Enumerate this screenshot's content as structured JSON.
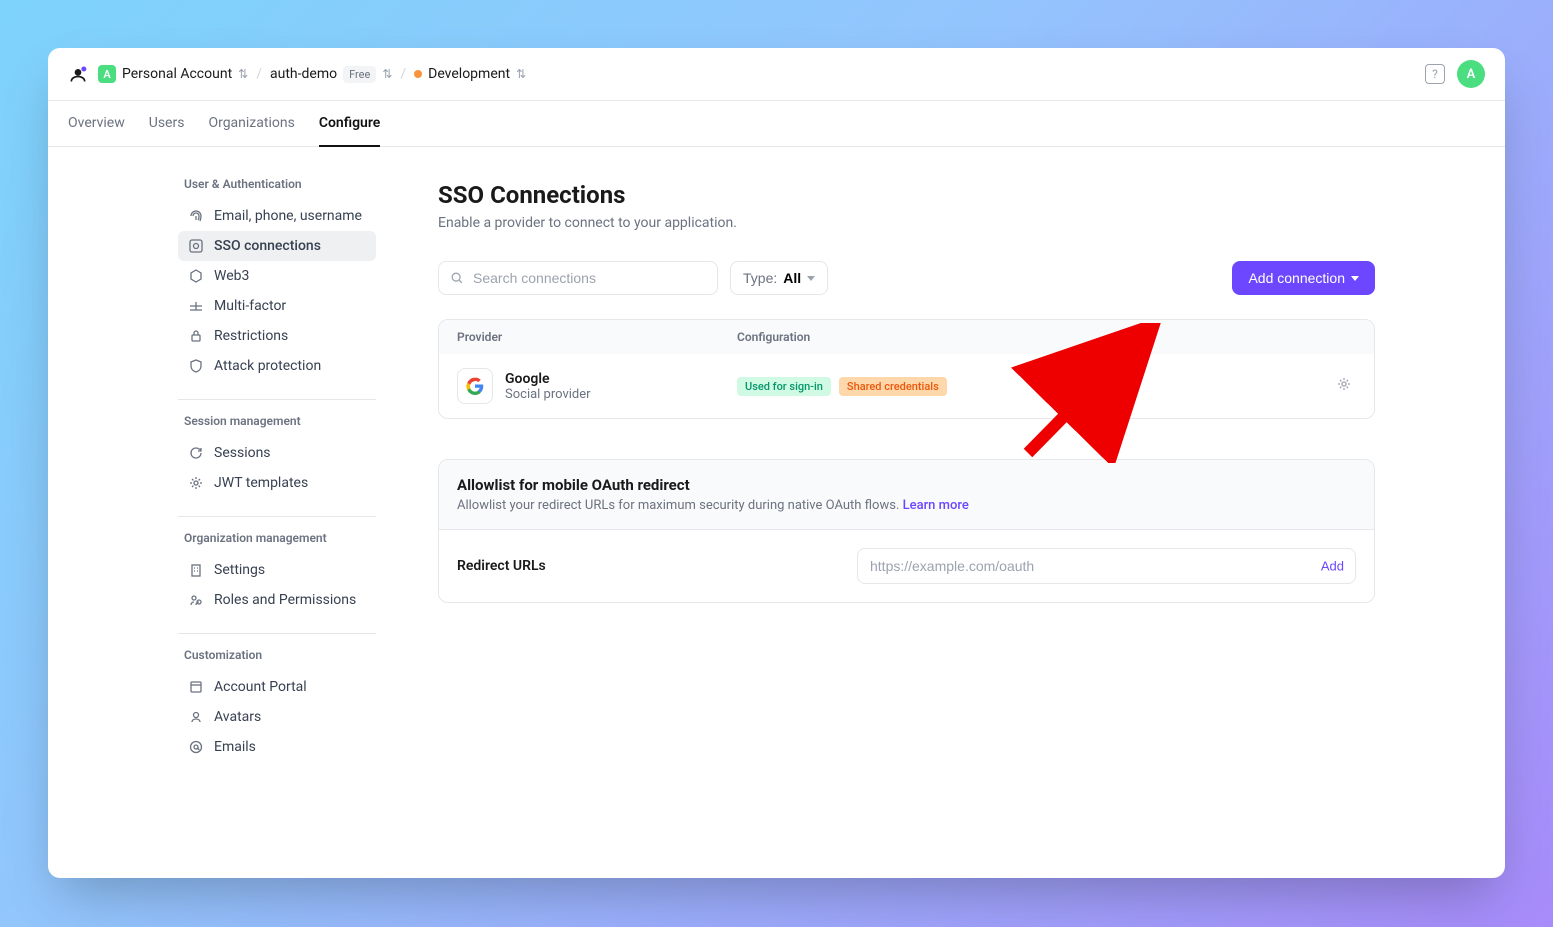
{
  "breadcrumb": {
    "account": "Personal Account",
    "account_badge": "A",
    "project": "auth-demo",
    "plan": "Free",
    "environment": "Development"
  },
  "avatar": {
    "letter": "A"
  },
  "tabs": [
    {
      "label": "Overview"
    },
    {
      "label": "Users"
    },
    {
      "label": "Organizations"
    },
    {
      "label": "Configure",
      "active": true
    }
  ],
  "sidebar": {
    "groups": [
      {
        "heading": "User & Authentication",
        "items": [
          {
            "icon": "fingerprint",
            "label": "Email, phone, username"
          },
          {
            "icon": "sso",
            "label": "SSO connections",
            "active": true
          },
          {
            "icon": "web3",
            "label": "Web3"
          },
          {
            "icon": "mfa",
            "label": "Multi-factor"
          },
          {
            "icon": "lock",
            "label": "Restrictions"
          },
          {
            "icon": "shield",
            "label": "Attack protection"
          }
        ]
      },
      {
        "heading": "Session management",
        "items": [
          {
            "icon": "refresh",
            "label": "Sessions"
          },
          {
            "icon": "gear",
            "label": "JWT templates"
          }
        ]
      },
      {
        "heading": "Organization management",
        "items": [
          {
            "icon": "building",
            "label": "Settings"
          },
          {
            "icon": "roles",
            "label": "Roles and Permissions"
          }
        ]
      },
      {
        "heading": "Customization",
        "items": [
          {
            "icon": "portal",
            "label": "Account Portal"
          },
          {
            "icon": "avatars",
            "label": "Avatars"
          },
          {
            "icon": "at",
            "label": "Emails"
          }
        ]
      }
    ]
  },
  "page": {
    "title": "SSO Connections",
    "subtitle": "Enable a provider to connect to your application."
  },
  "toolbar": {
    "search_placeholder": "Search connections",
    "type_label": "Type:",
    "type_value": "All",
    "add_label": "Add connection"
  },
  "table": {
    "header_provider": "Provider",
    "header_config": "Configuration",
    "rows": [
      {
        "name": "Google",
        "sub": "Social provider",
        "badges": [
          "Used for sign-in",
          "Shared credentials"
        ]
      }
    ]
  },
  "allowlist": {
    "title": "Allowlist for mobile OAuth redirect",
    "subtitle": "Allowlist your redirect URLs for maximum security during native OAuth flows. ",
    "learn_more": "Learn more",
    "redirect_label": "Redirect URLs",
    "redirect_placeholder": "https://example.com/oauth",
    "add_label": "Add"
  }
}
